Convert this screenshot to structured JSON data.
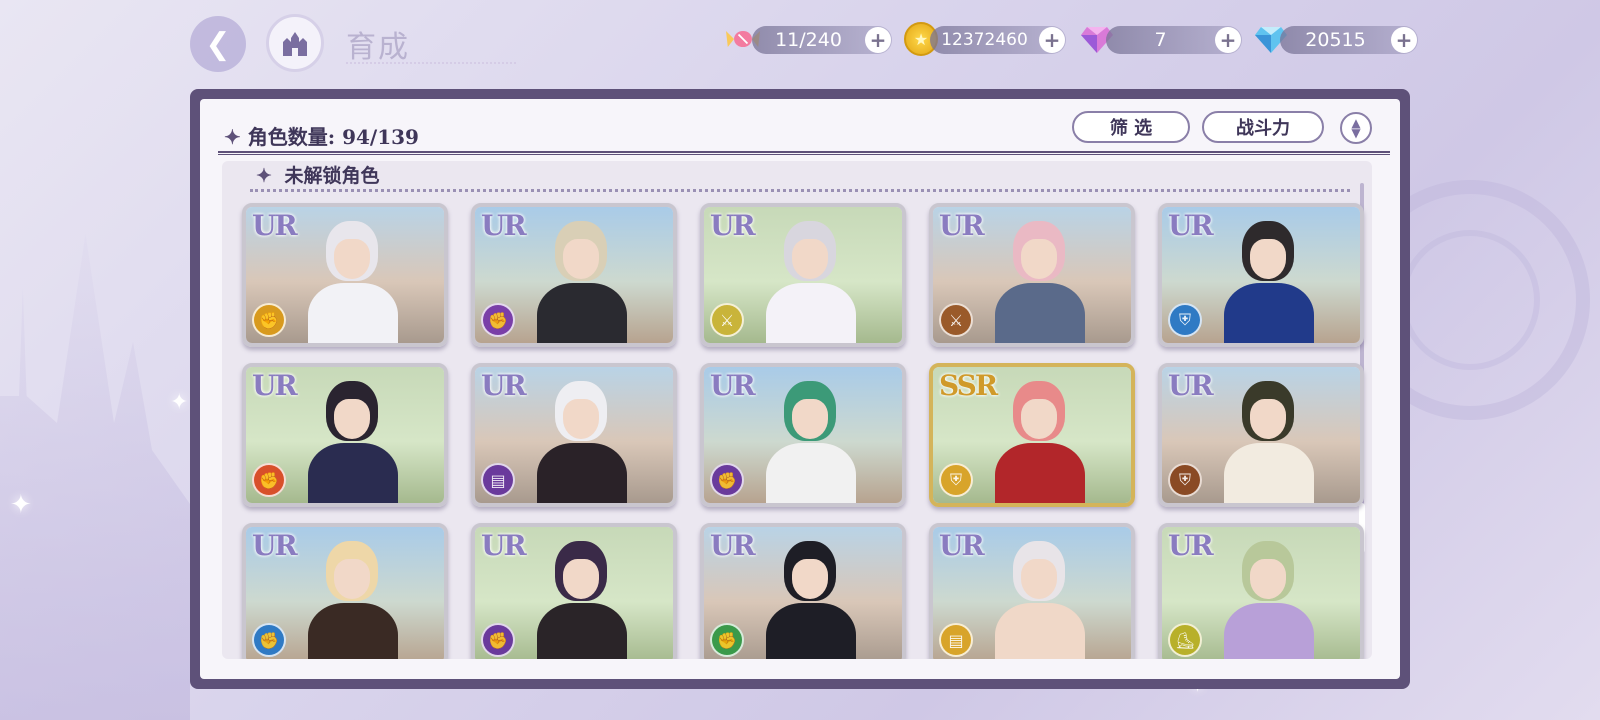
{
  "header": {
    "title": "育成",
    "back_icon": "back-arrow-icon",
    "home_icon": "castle-home-icon"
  },
  "resources": [
    {
      "name": "candy",
      "icon": "candy-icon",
      "value": "11/240"
    },
    {
      "name": "gold",
      "icon": "gold-coin-icon",
      "value": "12372460"
    },
    {
      "name": "gem",
      "icon": "pink-gem-icon",
      "value": "7"
    },
    {
      "name": "diamond",
      "icon": "blue-diamond-icon",
      "value": "20515"
    }
  ],
  "panel": {
    "count_label": "角色数量: 94/139",
    "filter_label": "筛 选",
    "sort_label": "战斗力",
    "section_title": "未解锁角色"
  },
  "cards": [
    {
      "rarity": "UR",
      "attr_icon": "fist-icon",
      "attr_color": "#d89a1e",
      "hair": "#e8e6ec",
      "outfit": "#f2f2f6"
    },
    {
      "rarity": "UR",
      "attr_icon": "fist-icon",
      "attr_color": "#7a3fa8",
      "hair": "#d9cfb6",
      "outfit": "#2a2a30"
    },
    {
      "rarity": "UR",
      "attr_icon": "sword-icon",
      "attr_color": "#c9b43a",
      "hair": "#d8d6de",
      "outfit": "#f4f2f8"
    },
    {
      "rarity": "UR",
      "attr_icon": "sword-icon",
      "attr_color": "#9a5a2a",
      "hair": "#eab9c4",
      "outfit": "#5a6a8a"
    },
    {
      "rarity": "UR",
      "attr_icon": "shield-icon",
      "attr_color": "#2f7ac4",
      "hair": "#2e2a2c",
      "outfit": "#213a8a"
    },
    {
      "rarity": "UR",
      "attr_icon": "fist-icon",
      "attr_color": "#d8502a",
      "hair": "#2a2430",
      "outfit": "#2a2c50"
    },
    {
      "rarity": "UR",
      "attr_icon": "book-icon",
      "attr_color": "#6a3a9c",
      "hair": "#eeeef2",
      "outfit": "#2a2228"
    },
    {
      "rarity": "UR",
      "attr_icon": "fist-icon",
      "attr_color": "#6a3a9c",
      "hair": "#3c9a78",
      "outfit": "#f1f1f1"
    },
    {
      "rarity": "SSR",
      "attr_icon": "shield-icon",
      "attr_color": "#d8a42a",
      "hair": "#e88a8a",
      "outfit": "#b2262a"
    },
    {
      "rarity": "UR",
      "attr_icon": "shield-icon",
      "attr_color": "#8a4a24",
      "hair": "#3a3a2a",
      "outfit": "#f2ebe0"
    },
    {
      "rarity": "UR",
      "attr_icon": "fist-icon",
      "attr_color": "#2f7ac4",
      "hair": "#eed7a8",
      "outfit": "#3a2a24"
    },
    {
      "rarity": "UR",
      "attr_icon": "fist-icon",
      "attr_color": "#6a3a9c",
      "hair": "#3a2a48",
      "outfit": "#2a2428"
    },
    {
      "rarity": "UR",
      "attr_icon": "fist-icon",
      "attr_color": "#3a9a4a",
      "hair": "#1e1e26",
      "outfit": "#1e1e26"
    },
    {
      "rarity": "UR",
      "attr_icon": "book-icon",
      "attr_color": "#d8a42a",
      "hair": "#e8e4e8",
      "outfit": "#f0d8c8"
    },
    {
      "rarity": "UR",
      "attr_icon": "boot-icon",
      "attr_color": "#b8b02a",
      "hair": "#b8c89a",
      "outfit": "#b8a0d8"
    }
  ]
}
